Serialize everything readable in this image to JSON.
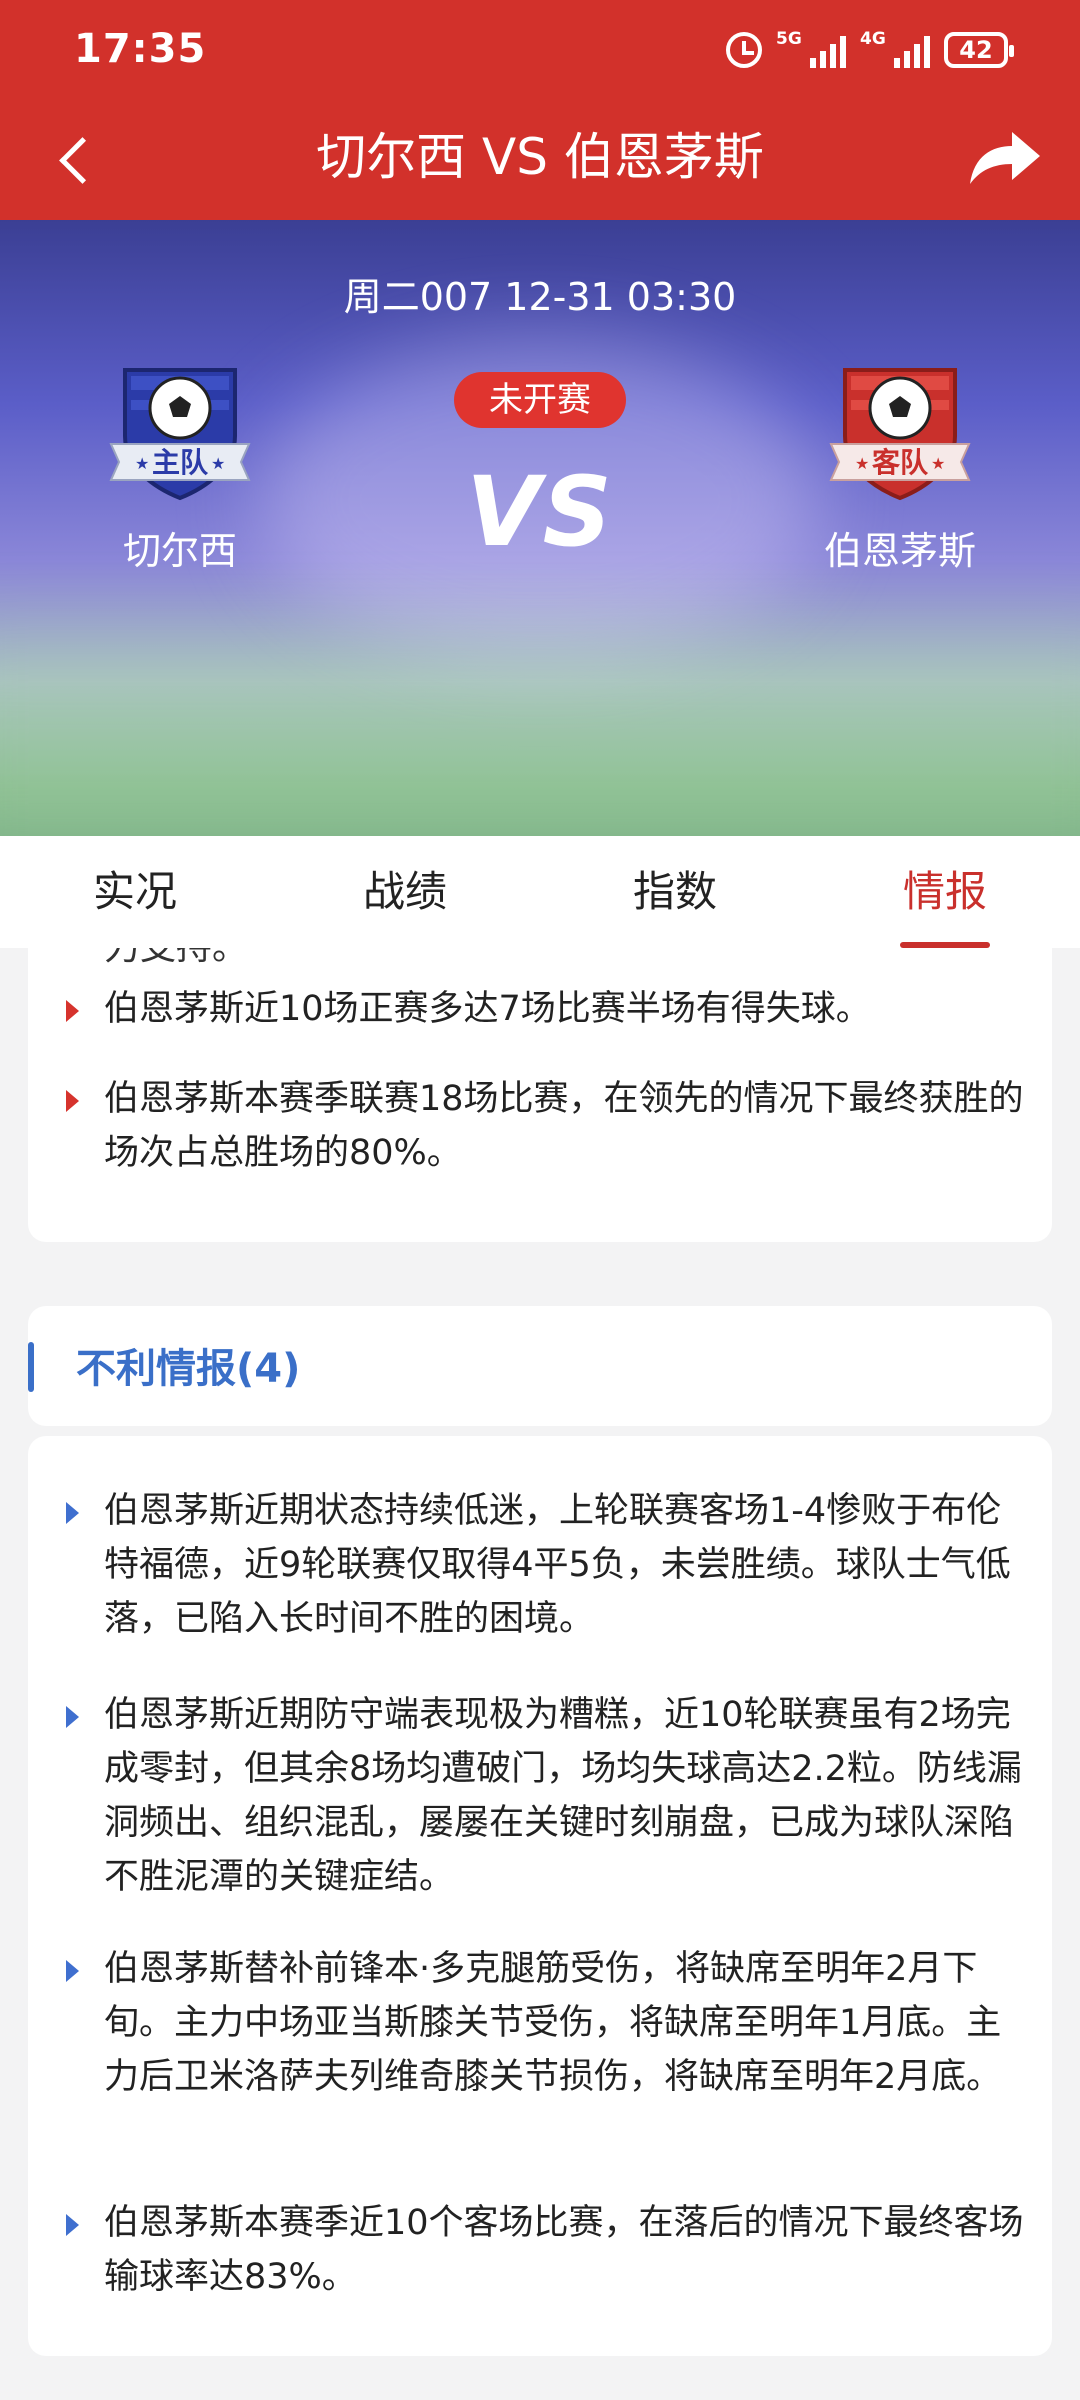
{
  "status_bar": {
    "time": "17:35",
    "signal1_label": "5G",
    "signal2_label": "4G",
    "battery": "42"
  },
  "header": {
    "title": "切尔西 VS 伯恩茅斯"
  },
  "match": {
    "datetime": "周二007 12-31 03:30",
    "status": "未开赛",
    "vs_text": "VS",
    "home": {
      "name": "切尔西",
      "badge": "主队",
      "color": "#2b3ba8"
    },
    "away": {
      "name": "伯恩茅斯",
      "badge": "客队",
      "color": "#c9302c"
    }
  },
  "tabs": [
    {
      "label": "实况",
      "active": false
    },
    {
      "label": "战绩",
      "active": false
    },
    {
      "label": "指数",
      "active": false
    },
    {
      "label": "情报",
      "active": true
    }
  ],
  "favorable": {
    "cut_text": "力支持。",
    "items": [
      "伯恩茅斯近10场正赛多达7场比赛半场有得失球。",
      "伯恩茅斯本赛季联赛18场比赛，在领先的情况下最终获胜的场次占总胜场的80%。"
    ]
  },
  "unfavorable": {
    "title": "不利情报(4)",
    "items": [
      "伯恩茅斯近期状态持续低迷，上轮联赛客场1-4惨败于布伦特福德，近9轮联赛仅取得4平5负，未尝胜绩。球队士气低落，已陷入长时间不胜的困境。",
      "伯恩茅斯近期防守端表现极为糟糕，近10轮联赛虽有2场完成零封，但其余8场均遭破门，场均失球高达2.2粒。防线漏洞频出、组织混乱，屡屡在关键时刻崩盘，已成为球队深陷不胜泥潭的关键症结。",
      "伯恩茅斯替补前锋本·多克腿筋受伤，将缺席至明年2月下旬。主力中场亚当斯膝关节受伤，将缺席至明年1月底。主力后卫米洛萨夫列维奇膝关节损伤，将缺席至明年2月底。",
      "伯恩茅斯本赛季近10个客场比赛，在落后的情况下最终客场输球率达83%。"
    ]
  },
  "colors": {
    "header_red": "#d2312b",
    "active_tab": "#c9302c",
    "section_blue": "#3a6fc8",
    "bullet_red": "#d6332d",
    "bullet_blue": "#3f6fcf"
  }
}
